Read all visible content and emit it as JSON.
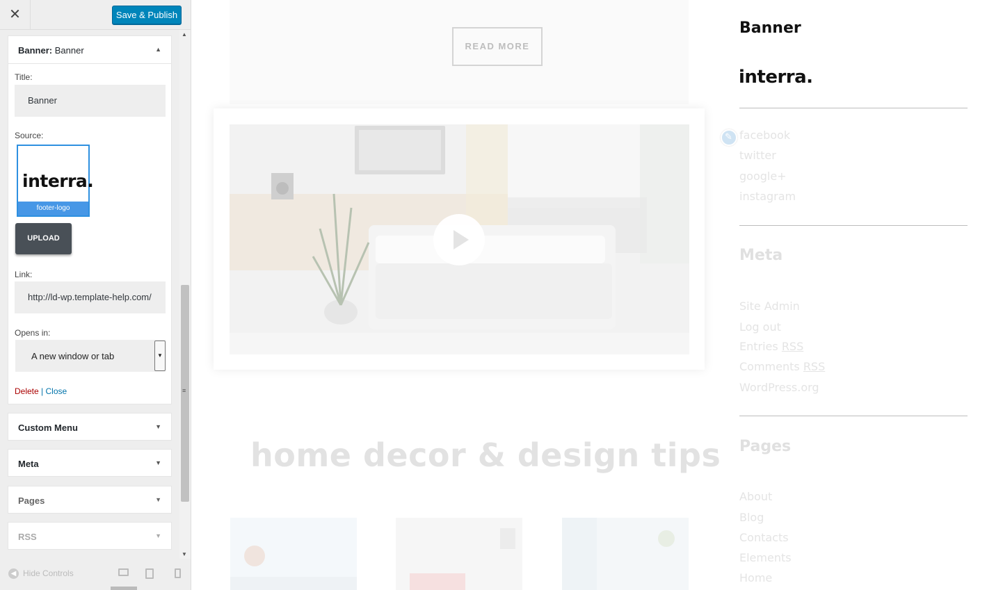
{
  "topbar": {
    "close_glyph": "✕",
    "save_label": "Save & Publish"
  },
  "banner_widget": {
    "header_type": "Banner",
    "header_sep": ": ",
    "header_name": "Banner",
    "title_label": "Title:",
    "title_value": "Banner",
    "source_label": "Source:",
    "source_image_text": "interra.",
    "source_caption": "footer-logo",
    "upload_label": "UPLOAD",
    "link_label": "Link:",
    "link_value": "http://ld-wp.template-help.com/",
    "opens_label": "Opens in:",
    "opens_value": "A new window or tab",
    "delete_label": "Delete",
    "separator": "|",
    "close_label": "Close"
  },
  "collapsed_widgets": [
    {
      "label": "Custom Menu"
    },
    {
      "label": "Meta"
    },
    {
      "label": "Pages"
    },
    {
      "label": "RSS"
    }
  ],
  "footer": {
    "hide_controls_label": "Hide Controls",
    "active_device": "desktop"
  },
  "preview": {
    "read_more_label": "READ MORE",
    "section_heading": "home decor & design tips",
    "sidebar": {
      "banner_title": "Banner",
      "logo_text": "interra.",
      "social_links": [
        "facebook",
        "twitter",
        "google+",
        "instagram"
      ],
      "meta_heading": "Meta",
      "meta_links": [
        "Site Admin",
        "Log out",
        "Entries ",
        "Comments ",
        "WordPress.org"
      ],
      "rss_abbr": "RSS",
      "pages_heading": "Pages",
      "pages_links": [
        "About",
        "Blog",
        "Contacts",
        "Elements",
        "Home"
      ]
    }
  },
  "colors": {
    "primary_button": "#0085ba",
    "selected_thumb_border": "#2e90e0",
    "upload_button": "#495057",
    "delete_link": "#aa0000",
    "close_link": "#0073aa"
  }
}
